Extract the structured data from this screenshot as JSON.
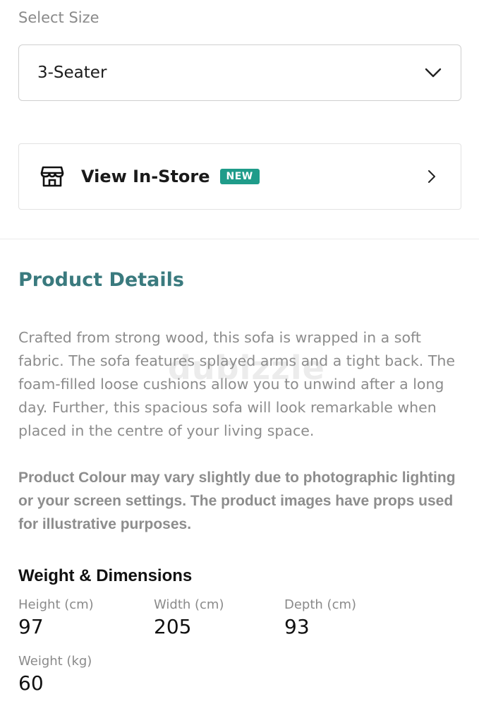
{
  "size_selector": {
    "label": "Select Size",
    "value": "3-Seater",
    "icon": "chevron-down-icon"
  },
  "store_card": {
    "title": "View In-Store",
    "badge": "NEW",
    "badge_color": "#1f9c8a",
    "icon": "store-icon",
    "chevron": "chevron-right-icon"
  },
  "product_details": {
    "title": "Product Details",
    "title_color": "#3a7a7e",
    "description": "Crafted from strong wood, this sofa is wrapped in a soft fabric. The sofa features splayed arms and a tight back. The foam-filled loose cushions allow you to unwind after a long day. Further, this spacious sofa will look remarkable when placed in the centre of your living space.",
    "note": "Product Colour may vary slightly due to photographic lighting or your screen settings. The product images have props used for illustrative purposes.",
    "watermark": "dubizzle"
  },
  "dimensions": {
    "title": "Weight & Dimensions",
    "height": {
      "label": "Height (cm)",
      "value": "97"
    },
    "width": {
      "label": "Width (cm)",
      "value": "205"
    },
    "depth": {
      "label": "Depth (cm)",
      "value": "93"
    },
    "weight": {
      "label": "Weight (kg)",
      "value": "60"
    }
  }
}
